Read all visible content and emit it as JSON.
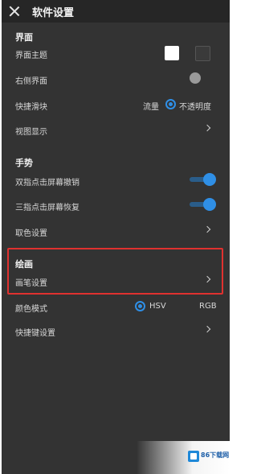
{
  "header": {
    "title": "软件设置"
  },
  "sections": {
    "interface": {
      "title": "界面",
      "theme_label": "界面主题",
      "right_panel_label": "右侧界面",
      "quick_slider_label": "快捷滑块",
      "quick_slider_opt1": "流量",
      "quick_slider_opt2": "不透明度",
      "view_display_label": "视图显示"
    },
    "gesture": {
      "title": "手势",
      "two_finger_label": "双指点击屏幕撤销",
      "three_finger_label": "三指点击屏幕恢复",
      "color_pick_label": "取色设置"
    },
    "painting": {
      "title": "绘画",
      "brush_settings_label": "画笔设置",
      "color_mode_label": "颜色模式",
      "color_mode_opt1": "HSV",
      "color_mode_opt2": "RGB",
      "shortcut_label": "快捷键设置"
    }
  },
  "watermark": {
    "text": "86下载网"
  },
  "colors": {
    "background": "#333333",
    "accent": "#2f8fe6",
    "highlight": "#e0312f"
  },
  "state": {
    "right_panel_on": false,
    "two_finger_undo_on": true,
    "three_finger_redo_on": true,
    "quick_slider_selected": "不透明度",
    "color_mode_selected": "HSV"
  }
}
